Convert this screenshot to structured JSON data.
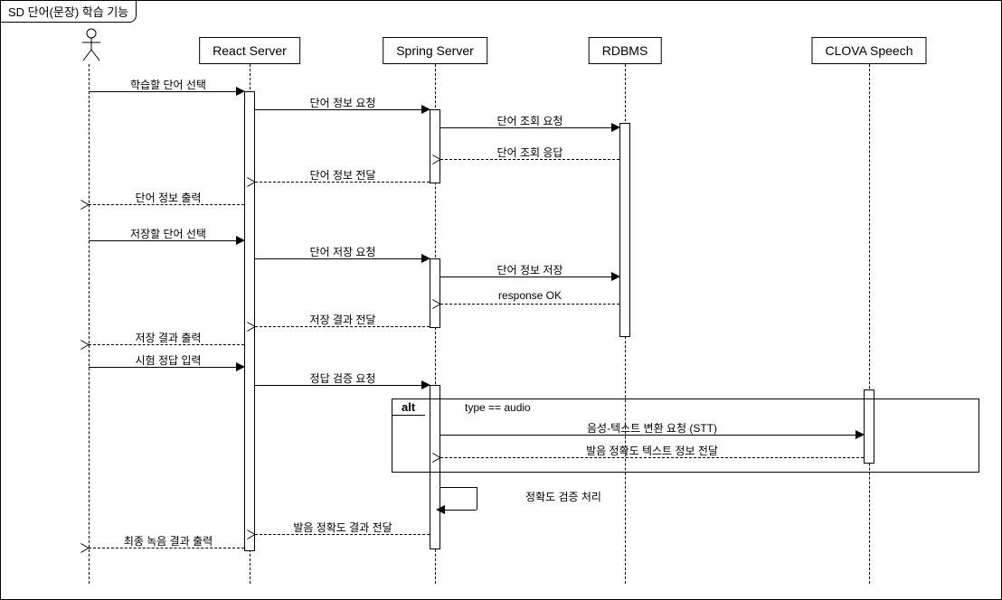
{
  "title": "SD 단어(문장) 학습 기능",
  "participants": {
    "actor": "",
    "react": "React Server",
    "spring": "Spring Server",
    "rdbms": "RDBMS",
    "clova": "CLOVA Speech"
  },
  "messages": {
    "m1": "학습할 단어 선택",
    "m2": "단어 정보 요청",
    "m3": "단어 조회 요청",
    "m4": "단어 조회 응답",
    "m5": "단어 정보 전달",
    "m6": "단어 정보 출력",
    "m7": "저장할 단어 선택",
    "m8": "단어 저장 요청",
    "m9": "단어 정보 저장",
    "m10": "response OK",
    "m11": "저장 결과 전달",
    "m12": "저장 결과 출력",
    "m13": "시험 정답 입력",
    "m14": "정답 검증 요청",
    "m15": "음성-텍스트 변환 요청 (STT)",
    "m16": "발음 정확도 텍스트 정보 전달",
    "m17": "정확도 검증 처리",
    "m18": "발음 정확도 결과 전달",
    "m19": "최종 녹음 결과 출력"
  },
  "alt": {
    "label": "alt",
    "guard": "type == audio"
  }
}
